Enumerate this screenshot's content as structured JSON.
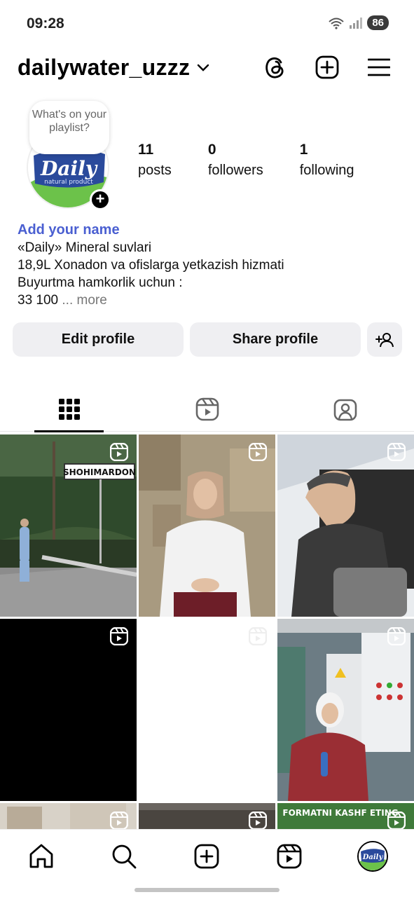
{
  "status": {
    "time": "09:28",
    "battery": "86"
  },
  "header": {
    "username": "dailywater_uzzz"
  },
  "profile": {
    "note": "What's on your playlist?",
    "logo_text": "Daily",
    "logo_sub": "natural product",
    "stats": [
      {
        "num": "11",
        "label": "posts"
      },
      {
        "num": "0",
        "label": "followers"
      },
      {
        "num": "1",
        "label": "following"
      }
    ]
  },
  "bio": {
    "add_name": "Add your name",
    "lines": [
      "«Daily» Mineral suvlari",
      "18,9L Xonadon va ofislarga yetkazish hizmati",
      "Buyurtma hamkorlik uchun :"
    ],
    "last_line": "33 100",
    "more": "... more"
  },
  "buttons": {
    "edit": "Edit profile",
    "share": "Share profile"
  },
  "grid": {
    "sign_text": "SHOHIMARDON",
    "banner_text": "FORMATNI KASHF ETING"
  },
  "colors": {
    "link_blue": "#4a5fd1",
    "button_bg": "#efeff2",
    "brand_blue": "#2a4a9c",
    "brand_green": "#6cc24a"
  }
}
